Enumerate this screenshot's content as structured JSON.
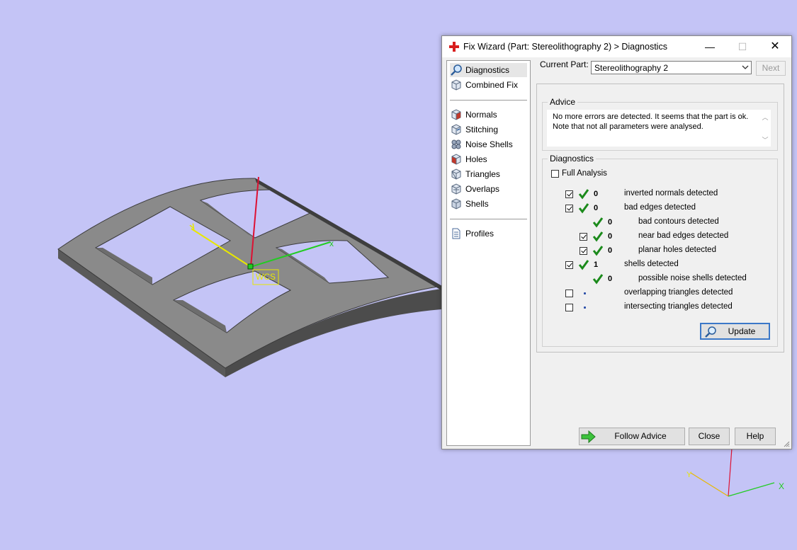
{
  "window": {
    "title": "Fix Wizard (Part: Stereolithography 2) > Diagnostics",
    "minimize": "—",
    "maximize": "☐",
    "close": "✕"
  },
  "nav": {
    "items": [
      {
        "label": "Diagnostics",
        "icon": "magnifier-icon"
      },
      {
        "label": "Combined Fix",
        "icon": "cube-icon"
      },
      {
        "label": "Normals",
        "icon": "normals-cube-icon"
      },
      {
        "label": "Stitching",
        "icon": "stitching-cube-icon"
      },
      {
        "label": "Noise Shells",
        "icon": "noise-shells-icon"
      },
      {
        "label": "Holes",
        "icon": "holes-cube-icon"
      },
      {
        "label": "Triangles",
        "icon": "triangles-cube-icon"
      },
      {
        "label": "Overlaps",
        "icon": "overlaps-cube-icon"
      },
      {
        "label": "Shells",
        "icon": "shells-cube-icon"
      },
      {
        "label": "Profiles",
        "icon": "document-icon"
      }
    ]
  },
  "current_part": {
    "label": "Current Part:",
    "value": "Stereolithography 2",
    "next": "Next"
  },
  "advice": {
    "title": "Advice",
    "line1": "No more errors are detected. It seems that the part is ok.",
    "line2": "Note that not all parameters were analysed."
  },
  "diagnostics": {
    "title": "Diagnostics",
    "full_analysis": "Full Analysis",
    "rows": [
      {
        "label": "inverted normals detected",
        "count": "0",
        "checked": true
      },
      {
        "label": "bad edges detected",
        "count": "0",
        "checked": true
      },
      {
        "label": "bad contours detected",
        "count": "0",
        "checked": null
      },
      {
        "label": "near bad edges detected",
        "count": "0",
        "checked": true
      },
      {
        "label": "planar holes detected",
        "count": "0",
        "checked": true
      },
      {
        "label": "shells detected",
        "count": "1",
        "checked": true
      },
      {
        "label": "possible noise shells detected",
        "count": "0",
        "checked": null
      },
      {
        "label": "overlapping triangles detected",
        "count": "",
        "checked": false
      },
      {
        "label": "intersecting triangles detected",
        "count": "",
        "checked": false
      }
    ],
    "update": "Update"
  },
  "buttons": {
    "follow_advice": "Follow Advice",
    "close": "Close",
    "help": "Help"
  },
  "viewport": {
    "wcs_label": "WCS",
    "axis_x": "x",
    "axis_y": "y",
    "axis_x_corner": "X",
    "axis_y_corner": "Y",
    "background": "#c4c4f6"
  },
  "colors": {
    "check_green": "#1b8a1b",
    "axis_x": "#22cc22",
    "axis_y": "#e8e800",
    "axis_z": "#dd1133",
    "accent_blue": "#3b78c8"
  }
}
